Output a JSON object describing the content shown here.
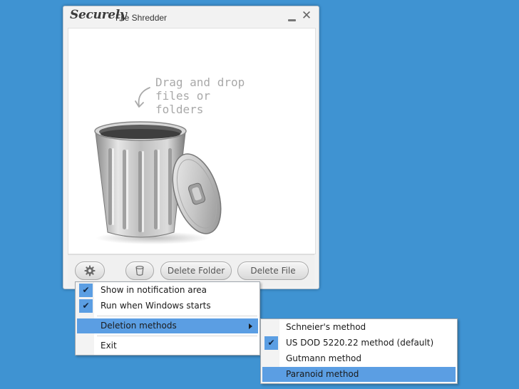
{
  "window": {
    "brand": "Securely",
    "title": "File Shredder",
    "minimize_icon": "minimize-icon",
    "close_icon": "close-icon",
    "close_glyph": "✕"
  },
  "drop_area": {
    "hint_line1": "Drag and drop",
    "hint_line2": "files or folders",
    "icon": "trash-can-icon"
  },
  "toolbar": {
    "settings_icon": "gear-icon",
    "bin_icon": "trash-icon",
    "delete_folder_label": "Delete Folder",
    "delete_file_label": "Delete File"
  },
  "main_menu": {
    "items": [
      {
        "label": "Show in notification area",
        "checked": true
      },
      {
        "label": "Run when Windows starts",
        "checked": true
      },
      {
        "label": "Deletion methods",
        "has_submenu": true,
        "highlighted": true
      },
      {
        "label": "Exit"
      }
    ]
  },
  "submenu": {
    "items": [
      {
        "label": "Schneier's method"
      },
      {
        "label": "US DOD 5220.22 method (default)",
        "checked": true
      },
      {
        "label": "Gutmann method"
      },
      {
        "label": "Paranoid method",
        "highlighted": true
      }
    ]
  },
  "check_glyph": "✔",
  "colors": {
    "desktop": "#3f93d2",
    "highlight": "#5b9ee3"
  }
}
